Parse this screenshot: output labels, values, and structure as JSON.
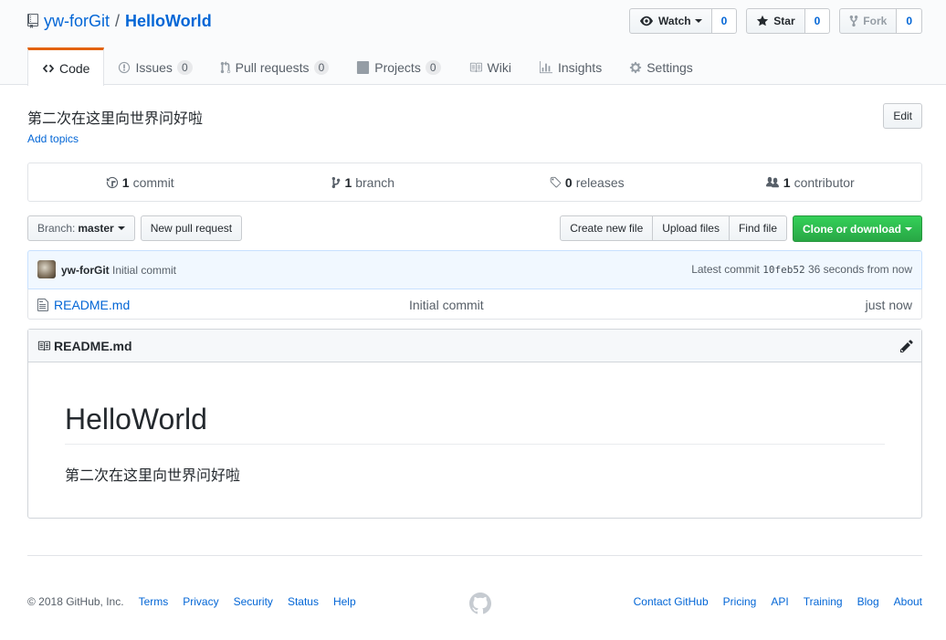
{
  "repo": {
    "owner": "yw-forGit",
    "separator": "/",
    "name": "HelloWorld"
  },
  "actions": {
    "watch_label": "Watch",
    "watch_count": "0",
    "star_label": "Star",
    "star_count": "0",
    "fork_label": "Fork",
    "fork_count": "0"
  },
  "nav": {
    "code": "Code",
    "issues": "Issues",
    "issues_count": "0",
    "pulls": "Pull requests",
    "pulls_count": "0",
    "projects": "Projects",
    "projects_count": "0",
    "wiki": "Wiki",
    "insights": "Insights",
    "settings": "Settings"
  },
  "description": "第二次在这里向世界问好啦",
  "add_topics": "Add topics",
  "edit_label": "Edit",
  "numbers": {
    "commits_num": "1",
    "commits_label": "commit",
    "branches_num": "1",
    "branches_label": "branch",
    "releases_num": "0",
    "releases_label": "releases",
    "contributors_num": "1",
    "contributors_label": "contributor"
  },
  "filebar": {
    "branch_prefix": "Branch:",
    "branch_name": "master",
    "new_pr": "New pull request",
    "create_file": "Create new file",
    "upload": "Upload files",
    "find": "Find file",
    "clone": "Clone or download"
  },
  "commit": {
    "author": "yw-forGit",
    "message": "Initial commit",
    "latest_prefix": "Latest commit",
    "sha": "10feb52",
    "age": "36 seconds from now"
  },
  "files": [
    {
      "name": "README.md",
      "message": "Initial commit",
      "age": "just now"
    }
  ],
  "readme": {
    "filename": "README.md",
    "heading": "HelloWorld",
    "body": "第二次在这里向世界问好啦"
  },
  "footer": {
    "copyright": "© 2018 GitHub, Inc.",
    "left_links": [
      "Terms",
      "Privacy",
      "Security",
      "Status",
      "Help"
    ],
    "right_links": [
      "Contact GitHub",
      "Pricing",
      "API",
      "Training",
      "Blog",
      "About"
    ]
  },
  "colors": {
    "accent": "#0366d6",
    "green": "#28a745",
    "tab_highlight": "#e36209"
  }
}
